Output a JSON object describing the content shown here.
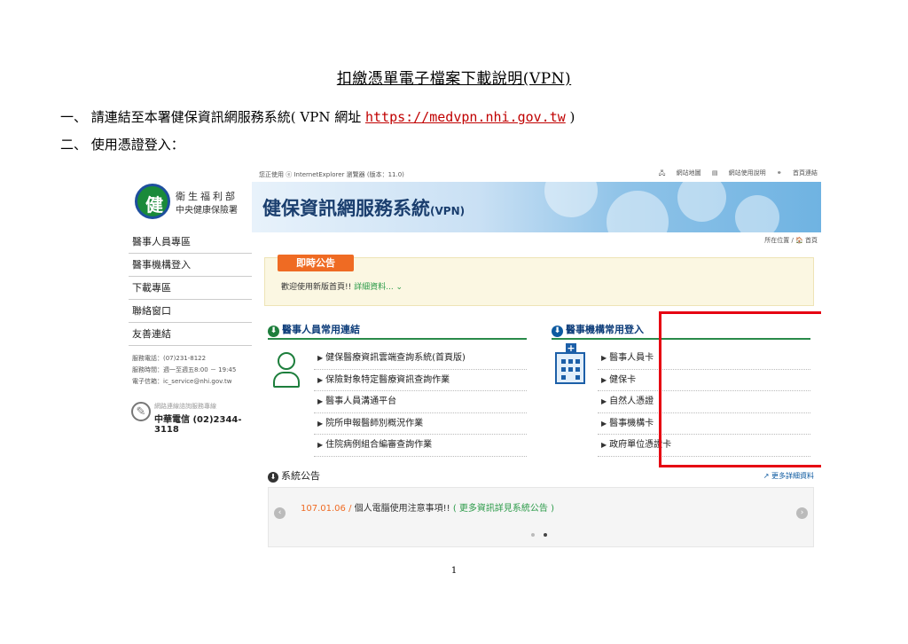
{
  "doc": {
    "title": "扣繳憑單電子檔案下載說明(VPN)",
    "step1_prefix": "一、 請連結至本署健保資訊網服務系統( VPN 網址 ",
    "step1_url": "https://medvpn.nhi.gov.tw",
    "step1_suffix": " )",
    "step2": "二、 使用憑證登入：",
    "page_number": "1"
  },
  "screenshot": {
    "logo": {
      "line1": "衛生福利部",
      "line2": "中央健康保險署",
      "badge": "健"
    },
    "side_menu": [
      "醫事人員專區",
      "醫事機構登入",
      "下載專區",
      "聯絡窗口",
      "友善連結"
    ],
    "contact": {
      "phone": "服務電話：(07)231-8122",
      "hours": "服務時間：週一至週五8:00 － 19:45",
      "email": "電子信箱：ic_service@nhi.gov.tw"
    },
    "hotline": {
      "label": "網路連線諮詢服務專線",
      "number": "中華電信 (02)2344-3118"
    },
    "topbar": {
      "browser_note": "您正使用 ⓔ InternetExplorer 瀏覽器 (版本：11.0)",
      "links": [
        "網站地圖",
        "網站使用說明",
        "首頁連結"
      ]
    },
    "banner": {
      "title": "健保資訊網服務系統",
      "suffix": "(VPN)"
    },
    "breadcrumb": "所在位置 / 🏠 首頁",
    "announcement": {
      "tag": "即時公告",
      "text": "歡迎使用新版首頁!!",
      "more": "詳細資料... ⌄"
    },
    "staff_section": {
      "title": "醫事人員常用連結",
      "items": [
        "健保醫療資訊雲端查詢系統(首頁版)",
        "保險對象特定醫療資訊查詢作業",
        "醫事人員溝通平台",
        "院所申報醫師別概況作業",
        "住院病例組合編審查詢作業"
      ]
    },
    "org_section": {
      "title": "醫事機構常用登入",
      "items": [
        "醫事人員卡",
        "健保卡",
        "自然人憑證",
        "醫事機構卡",
        "政府單位憑證卡"
      ]
    },
    "system_notice": {
      "title": "系統公告",
      "more": "更多詳細資料",
      "date": "107.01.06 /",
      "text": " 個人電腦使用注意事項!! ",
      "link": "( 更多資訊詳見系統公告 )"
    },
    "colors": {
      "highlight_box": "#e60012",
      "accent_orange": "#ef6b23",
      "section_green": "#2a8a4a",
      "link_red": "#c00000"
    }
  }
}
